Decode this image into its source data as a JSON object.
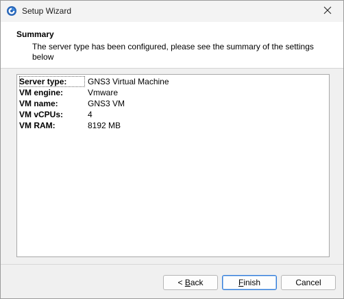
{
  "window": {
    "title": "Setup Wizard",
    "icon": "gns3-logo-icon",
    "close_icon": "close-icon"
  },
  "header": {
    "title": "Summary",
    "subtitle": "The server type has been configured, please see the summary of the settings below"
  },
  "summary": {
    "rows": [
      {
        "key": "Server type:",
        "value": "GNS3 Virtual Machine"
      },
      {
        "key": "VM engine:",
        "value": "Vmware"
      },
      {
        "key": "VM name:",
        "value": "GNS3 VM"
      },
      {
        "key": "VM vCPUs:",
        "value": "4"
      },
      {
        "key": "VM RAM:",
        "value": "8192 MB"
      }
    ]
  },
  "buttons": {
    "back": {
      "prefix": "< ",
      "mnemonic": "B",
      "rest": "ack"
    },
    "finish": {
      "mnemonic": "F",
      "rest": "inish"
    },
    "cancel": "Cancel"
  },
  "colors": {
    "default_button_border": "#2f7ad8",
    "header_bg": "#ffffff",
    "window_bg": "#f0f0f0"
  }
}
